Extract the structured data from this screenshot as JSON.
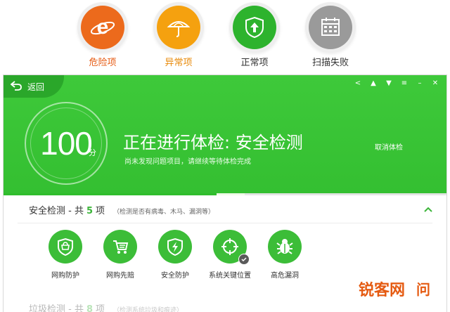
{
  "legend": [
    {
      "label": "危险项",
      "icon": "ie-e-icon",
      "color": "#ec6a1c",
      "label_color": "#e65a12"
    },
    {
      "label": "异常项",
      "icon": "umbrella-icon",
      "color": "#f5a10f",
      "label_color": "#e88a0a"
    },
    {
      "label": "正常项",
      "icon": "shield-arrow-icon",
      "color": "#2db32d",
      "label_color": "#333333"
    },
    {
      "label": "扫描失败",
      "icon": "calendar-icon",
      "color": "#9a9a9a",
      "label_color": "#333333"
    }
  ],
  "window": {
    "back_label": "返回",
    "score": "100",
    "score_unit": "分",
    "headline": "正在进行体检: 安全检测",
    "subline": "尚未发现问题项目，请继续等待体检完成",
    "cancel_label": "取消体检",
    "progress": 0.5
  },
  "section": {
    "title": "安全检测 - 共",
    "count": "5",
    "unit": "项",
    "note": "（检测是否有病毒、木马、漏洞等）",
    "items": [
      {
        "label": "网购防护",
        "icon": "shopping-shield-icon"
      },
      {
        "label": "网购先赔",
        "icon": "shopping-cart-icon"
      },
      {
        "label": "安全防护",
        "icon": "lightning-shield-icon"
      },
      {
        "label": "系统关键位置",
        "icon": "crosshair-icon"
      },
      {
        "label": "高危漏洞",
        "icon": "bug-icon"
      }
    ]
  },
  "next_section": {
    "title": "垃圾检测 - 共",
    "count": "8",
    "unit": "项",
    "note": "（检测系统垃圾和痕迹）"
  },
  "watermark": {
    "text": "锐客网",
    "suffix": "问"
  },
  "colors": {
    "banner": "#36c232",
    "accent": "#3cb53a"
  }
}
